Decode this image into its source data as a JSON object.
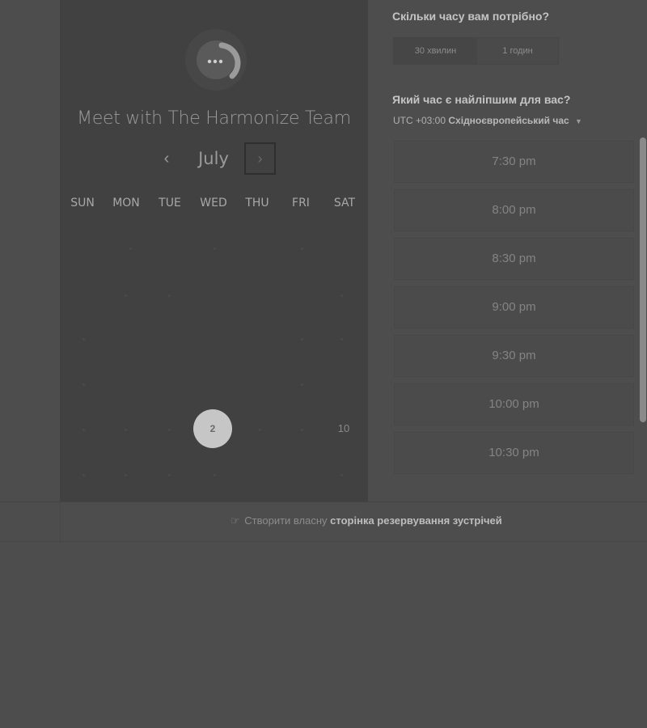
{
  "calendar": {
    "title": "Meet with The Harmonize Team",
    "month": "July",
    "prev_icon": "‹",
    "next_icon": "›",
    "weekdays": [
      "SUN",
      "MON",
      "TUE",
      "WED",
      "THU",
      "FRI",
      "SAT"
    ],
    "selected_day": "2",
    "visible_day": "10"
  },
  "duration": {
    "question": "Скільки часу вам потрібно?",
    "options": [
      "30 хвилин",
      "1 годин"
    ]
  },
  "time": {
    "question": "Який час є найліпшим для вас?",
    "timezone_offset": "UTC +03:00",
    "timezone_name": "Східноєвропейський час",
    "slots": [
      "7:30 pm",
      "8:00 pm",
      "8:30 pm",
      "9:00 pm",
      "9:30 pm",
      "10:00 pm",
      "10:30 pm"
    ]
  },
  "footer": {
    "prefix": "Створити власну",
    "link": "сторінка резервування зустрічей"
  }
}
